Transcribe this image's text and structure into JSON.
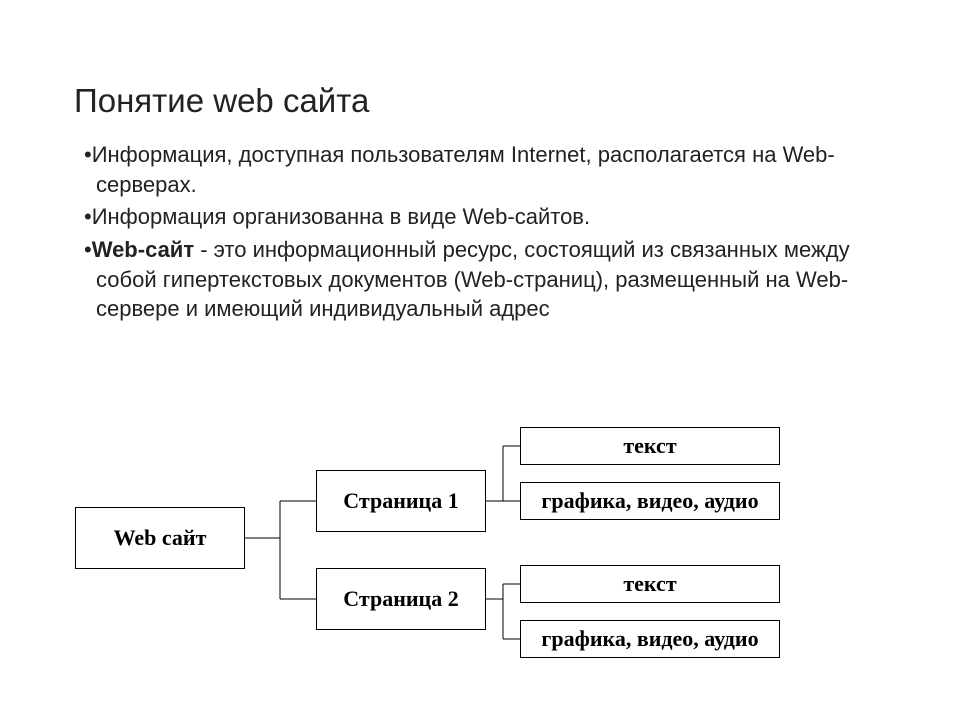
{
  "title": "Понятие web сайта",
  "bullets": {
    "b1": "Информация, доступная пользователям Internet, располагается на Web-серверах.",
    "b2": "Информация организованна в виде Web-сайтов.",
    "b3_strong": "Web-сайт",
    "b3_rest": " - это информационный ресурс, состоящий из связанных между собой гипертекстовых документов (Web-страниц), размещенный на Web-сервере и имеющий индивидуальный адрес"
  },
  "diagram": {
    "root": "Web сайт",
    "page1": "Страница 1",
    "page2": "Страница 2",
    "leaf1": "текст",
    "leaf2": "графика, видео, аудио",
    "leaf3": "текст",
    "leaf4": "графика, видео, аудио"
  }
}
